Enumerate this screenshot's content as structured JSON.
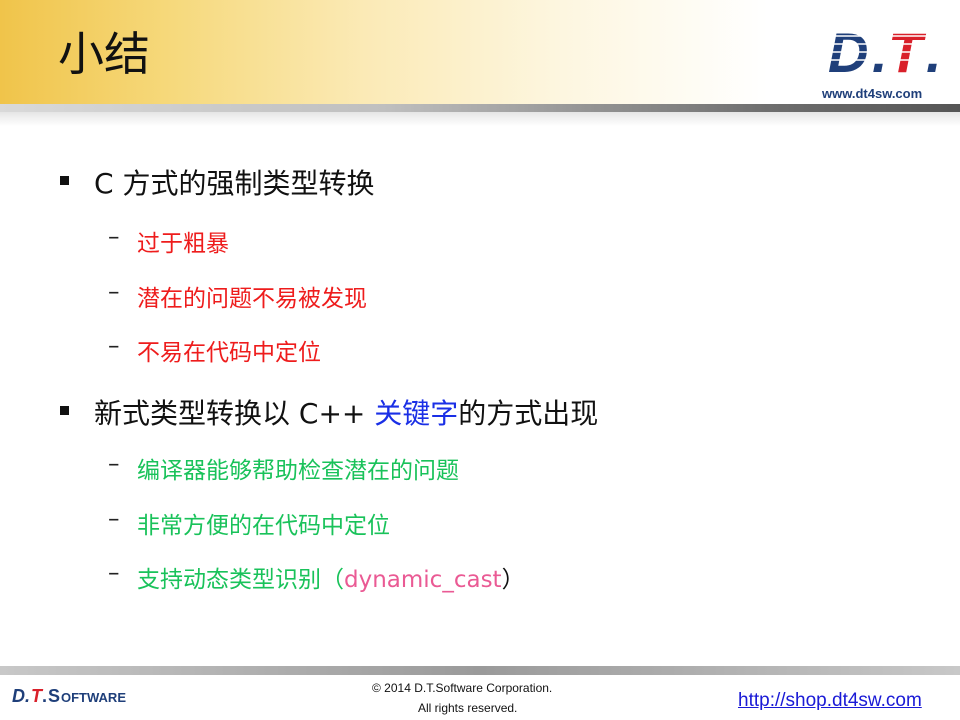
{
  "header": {
    "title": "小结",
    "logo_text": "D.T.",
    "logo_url": "www.dt4sw.com"
  },
  "sections": [
    {
      "text": "C 方式的强制类型转换",
      "items": [
        {
          "text": "过于粗暴",
          "color": "#ee1c1c"
        },
        {
          "text": "潜在的问题不易被发现",
          "color": "#ee1c1c"
        },
        {
          "text": "不易在代码中定位",
          "color": "#ee1c1c"
        }
      ]
    },
    {
      "text_before": "新式类型转换以 C++ ",
      "text_highlight": "关键字",
      "text_after": "的方式出现",
      "highlight_color": "#1a2fe6",
      "items": [
        {
          "text": "编译器能够帮助检查潜在的问题",
          "color": "#19c25a"
        },
        {
          "text": "非常方便的在代码中定位",
          "color": "#19c25a"
        },
        {
          "text_before": "支持动态类型识别（",
          "text_code": "dynamic_cast",
          "text_after": "）",
          "color": "#19c25a",
          "code_color": "#ea5a94"
        }
      ]
    }
  ],
  "footer": {
    "brand": "D.T.SOFTWARE",
    "copyright": "© 2014 D.T.Software Corporation.",
    "rights": "All rights reserved.",
    "link": "http://shop.dt4sw.com"
  },
  "colors": {
    "accent_header": "#f0c44a",
    "logo_blue": "#1f3f7a",
    "logo_red": "#d9202a"
  }
}
